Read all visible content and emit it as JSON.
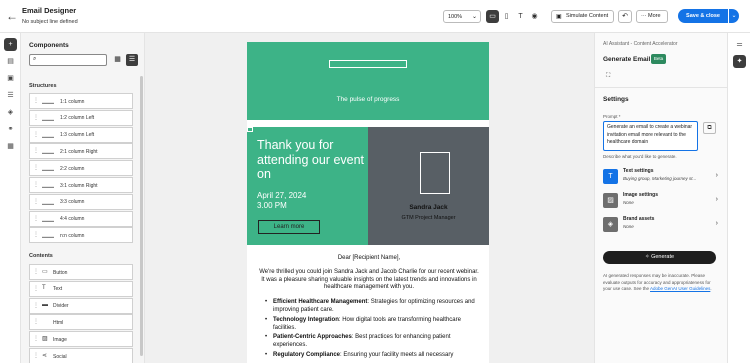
{
  "header": {
    "title": "Email Designer",
    "subtitle": "No subject line defined",
    "zoom": "100%",
    "simulate_label": "Simulate Content",
    "more_label": "More",
    "save_label": "Save & close"
  },
  "components": {
    "title": "Components",
    "structures_label": "Structures",
    "structures": [
      "1:1 column",
      "1:2 column Left",
      "1:3 column Left",
      "2:1 column Right",
      "2:2 column",
      "3:1 column Right",
      "3:3 column",
      "4:4 column",
      "n:n column"
    ],
    "contents_label": "Contents",
    "contents": [
      {
        "label": "Button",
        "icon": "button-icon"
      },
      {
        "label": "Text",
        "icon": "text-icon"
      },
      {
        "label": "Divider",
        "icon": "divider-icon"
      },
      {
        "label": "Html",
        "icon": "html-icon"
      },
      {
        "label": "Image",
        "icon": "image-icon"
      },
      {
        "label": "Social",
        "icon": "social-icon"
      }
    ]
  },
  "email": {
    "banner_tagline": "The pulse of progress",
    "hero_title": "Thank you for attending  our event on",
    "hero_date": "April 27, 2024",
    "hero_time": "3.00 PM",
    "learn_more": "Learn more",
    "speaker_name": "Sandra Jack",
    "speaker_role": "GTM Project Manager",
    "greeting": "Dear [Recipient Name],",
    "intro": "We're thrilled you could join Sandra Jack and Jacob Charlie for our recent webinar. It was a pleasure sharing valuable insights on the latest trends and innovations in healthcare management with you.",
    "bullets": [
      {
        "bold": "Efficient Healthcare Management",
        "text": ": Strategies for optimizing resources and improving patient care."
      },
      {
        "bold": "Technology Integration",
        "text": ": How digital tools are transforming healthcare facilities."
      },
      {
        "bold": "Patient-Centric Approaches",
        "text": ": Best practices for enhancing patient experiences."
      },
      {
        "bold": "Regulatory Compliance",
        "text": ": Ensuring your facility meets all necessary"
      }
    ],
    "colors": {
      "green": "#3db387",
      "slate": "#585f65"
    }
  },
  "ai_panel": {
    "breadcrumb": "AI Assistant - Content Accelerator",
    "title": "Generate Email",
    "badge": "Beta",
    "settings_title": "Settings",
    "prompt_label": "Prompt",
    "prompt_required": "*",
    "prompt_value": "Generate an email to create a webinar invitation email more relevant to the healthcare domain",
    "prompt_help": "Describe what you'd like to generate.",
    "settings": [
      {
        "name": "Text settings",
        "value": "Buying group, Marketing journey st...",
        "icon": "text-settings-icon"
      },
      {
        "name": "Image settings",
        "value": "None",
        "icon": "image-settings-icon"
      },
      {
        "name": "Brand assets",
        "value": "None",
        "icon": "brand-assets-icon"
      }
    ],
    "generate_label": "Generate",
    "disclaimer": "AI generated responses may be inaccurate. Please evaluate outputs for accuracy and appropriateness for your use case. See the",
    "disclaimer_link": "Adobe GenAI User Guidelines",
    "disclaimer_end": "."
  },
  "accent": "#1473e6"
}
